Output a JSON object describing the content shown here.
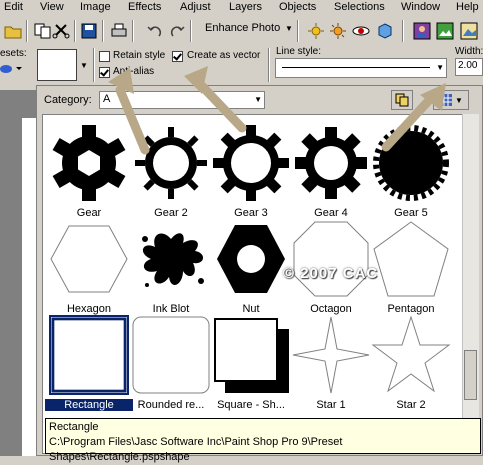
{
  "menu": [
    "Edit",
    "View",
    "Image",
    "Effects",
    "Adjust",
    "Layers",
    "Objects",
    "Selections",
    "Window",
    "Help"
  ],
  "toolbar": {
    "enhance_label": "Enhance Photo"
  },
  "options": {
    "presets_label": "esets:",
    "retain_style": "Retain style",
    "create_as_vector": "Create as vector",
    "anti_alias": "Anti-alias",
    "line_style_label": "Line style:",
    "width_label": "Width:",
    "width_value": "2.00"
  },
  "popup": {
    "category_label": "Category:",
    "category_value": "A"
  },
  "shapes": [
    {
      "label": "Gear",
      "icon": "gear-icon"
    },
    {
      "label": "Gear 2",
      "icon": "gear-2-icon"
    },
    {
      "label": "Gear 3",
      "icon": "gear-3-icon"
    },
    {
      "label": "Gear 4",
      "icon": "gear-4-icon"
    },
    {
      "label": "Gear 5",
      "icon": "gear-5-icon"
    },
    {
      "label": "Hexagon",
      "icon": "hexagon-icon"
    },
    {
      "label": "Ink Blot",
      "icon": "ink-blot-icon"
    },
    {
      "label": "Nut",
      "icon": "nut-icon"
    },
    {
      "label": "Octagon",
      "icon": "octagon-icon"
    },
    {
      "label": "Pentagon",
      "icon": "pentagon-icon"
    },
    {
      "label": "Rectangle",
      "icon": "rectangle-icon"
    },
    {
      "label": "Rounded re...",
      "icon": "rounded-rectangle-icon"
    },
    {
      "label": "Square - Sh...",
      "icon": "square-shadow-icon"
    },
    {
      "label": "Star 1",
      "icon": "star-1-icon"
    },
    {
      "label": "Star 2",
      "icon": "star-2-icon"
    }
  ],
  "watermark": "© 2007 CAC",
  "tooltip": {
    "line1": "Rectangle",
    "line2": "C:\\Program Files\\Jasc Software Inc\\Paint Shop Pro 9\\Preset Shapes\\Rectangle.pspshape"
  }
}
